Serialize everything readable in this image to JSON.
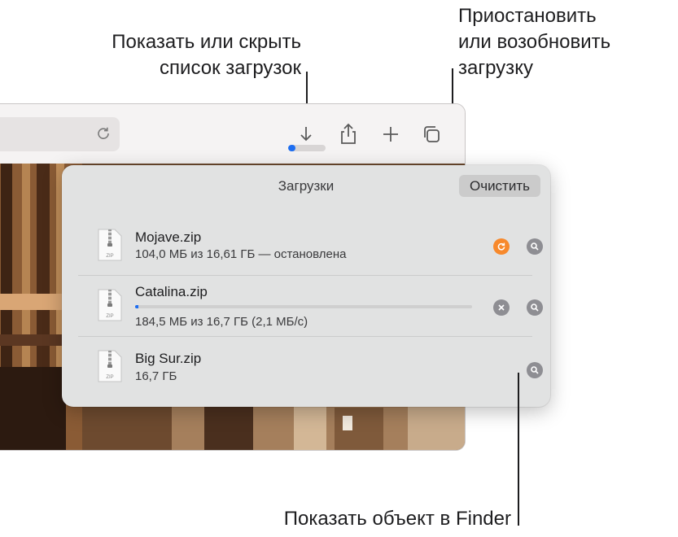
{
  "callouts": {
    "toggle_list": [
      "Показать или скрыть",
      "список загрузок"
    ],
    "pause_resume": [
      "Приостановить",
      "или возобновить",
      "загрузку"
    ],
    "show_in_finder": "Показать объект в Finder"
  },
  "popover": {
    "title": "Загрузки",
    "clear_label": "Очистить",
    "items": [
      {
        "name": "Mojave.zip",
        "status": "104,0 МБ из 16,61 ГБ — остановлена",
        "state": "paused",
        "icon": "zip-file-icon"
      },
      {
        "name": "Catalina.zip",
        "status": "184,5 МБ из 16,7 ГБ (2,1 МБ/с)",
        "state": "downloading",
        "progress": 0.01,
        "icon": "zip-file-icon"
      },
      {
        "name": "Big Sur.zip",
        "status": "16,7 ГБ",
        "state": "completed",
        "icon": "zip-file-icon"
      }
    ]
  },
  "file_icon_label": "ZIP",
  "toolbar": {
    "download_progress": 0.2,
    "icons": [
      "reload-icon",
      "downloads-icon",
      "share-icon",
      "new-tab-icon",
      "tabs-overview-icon"
    ]
  },
  "colors": {
    "accent_blue": "#1e6ef1",
    "resume_orange": "#f7892c",
    "button_gray": "#8e8e93",
    "popover_bg": "#e1e2e2"
  }
}
